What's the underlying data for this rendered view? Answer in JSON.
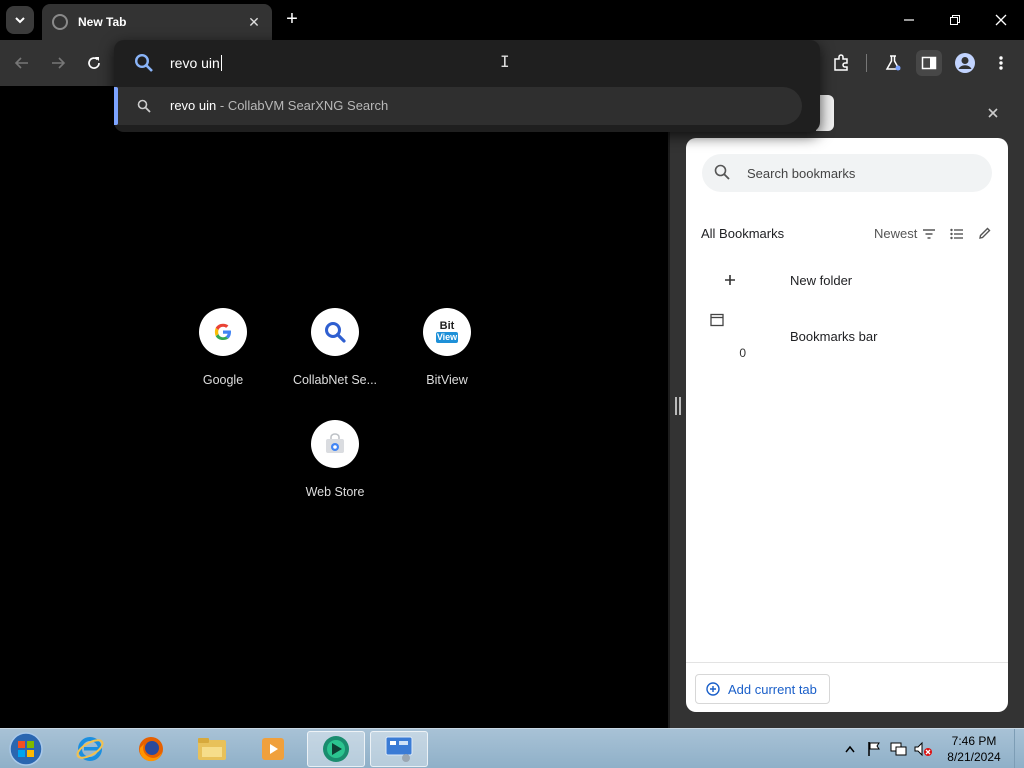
{
  "browser": {
    "tab_title": "New Tab",
    "new_tab_symbol": "+",
    "close_symbol": "✕"
  },
  "omnibox": {
    "typed_text": "revo uin",
    "suggestion": {
      "query": "revo uin",
      "separator": " - ",
      "engine": "CollabVM SearXNG Search"
    }
  },
  "shortcuts": [
    {
      "label": "Google",
      "icon": "google-icon"
    },
    {
      "label": "CollabNet Se...",
      "icon": "search-magnifier-icon"
    },
    {
      "label": "BitView",
      "icon": "bitview-icon",
      "logo_line1": "Bit",
      "logo_line2": "View"
    },
    {
      "label": "Web Store",
      "icon": "web-store-icon"
    }
  ],
  "bookmarks_panel": {
    "search_placeholder": "Search bookmarks",
    "heading": "All Bookmarks",
    "sort_label": "Newest",
    "items": [
      {
        "label": "New folder",
        "icon": "plus-icon"
      },
      {
        "label": "Bookmarks bar",
        "icon": "folder-icon",
        "count": "0"
      }
    ],
    "add_button": "Add current tab"
  },
  "taskbar": {
    "apps": [
      "internet-explorer-icon",
      "firefox-icon",
      "file-explorer-icon",
      "media-player-icon",
      "app-green-icon",
      "control-panel-icon"
    ],
    "time": "7:46 PM",
    "date": "8/21/2024"
  },
  "colors": {
    "accent": "#7ca3ff",
    "link": "#1a5fc9",
    "toolbar": "#333333"
  }
}
